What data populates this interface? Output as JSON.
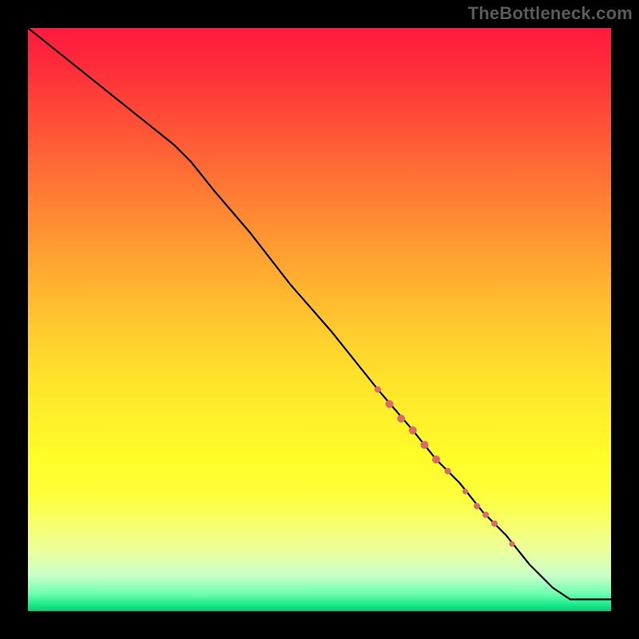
{
  "watermark": "TheBottleneck.com",
  "colors": {
    "marker": "#d96a6a",
    "line": "#000000"
  },
  "chart_data": {
    "type": "line",
    "title": "",
    "xlabel": "",
    "ylabel": "",
    "xlim": [
      0,
      100
    ],
    "ylim": [
      0,
      100
    ],
    "grid": false,
    "x": [
      0,
      5,
      10,
      15,
      20,
      25,
      28,
      32,
      38,
      45,
      52,
      60,
      66,
      70,
      74,
      78,
      82,
      86,
      88,
      90,
      93,
      100
    ],
    "values": [
      100,
      96,
      92,
      88,
      84,
      80,
      77,
      72,
      65,
      56,
      48,
      38,
      31,
      26,
      22,
      17,
      13,
      8,
      6,
      4,
      2,
      2
    ],
    "markers": [
      {
        "x": 60,
        "y": 38,
        "r": 4
      },
      {
        "x": 62,
        "y": 35.5,
        "r": 5
      },
      {
        "x": 64,
        "y": 33,
        "r": 5
      },
      {
        "x": 66,
        "y": 31,
        "r": 5
      },
      {
        "x": 68,
        "y": 28.5,
        "r": 5
      },
      {
        "x": 70,
        "y": 26,
        "r": 5
      },
      {
        "x": 72,
        "y": 24,
        "r": 4
      },
      {
        "x": 75,
        "y": 20.5,
        "r": 3.5
      },
      {
        "x": 77,
        "y": 18,
        "r": 4
      },
      {
        "x": 78.5,
        "y": 16.5,
        "r": 4
      },
      {
        "x": 80,
        "y": 15,
        "r": 4
      },
      {
        "x": 83,
        "y": 11.5,
        "r": 3.5
      }
    ]
  }
}
